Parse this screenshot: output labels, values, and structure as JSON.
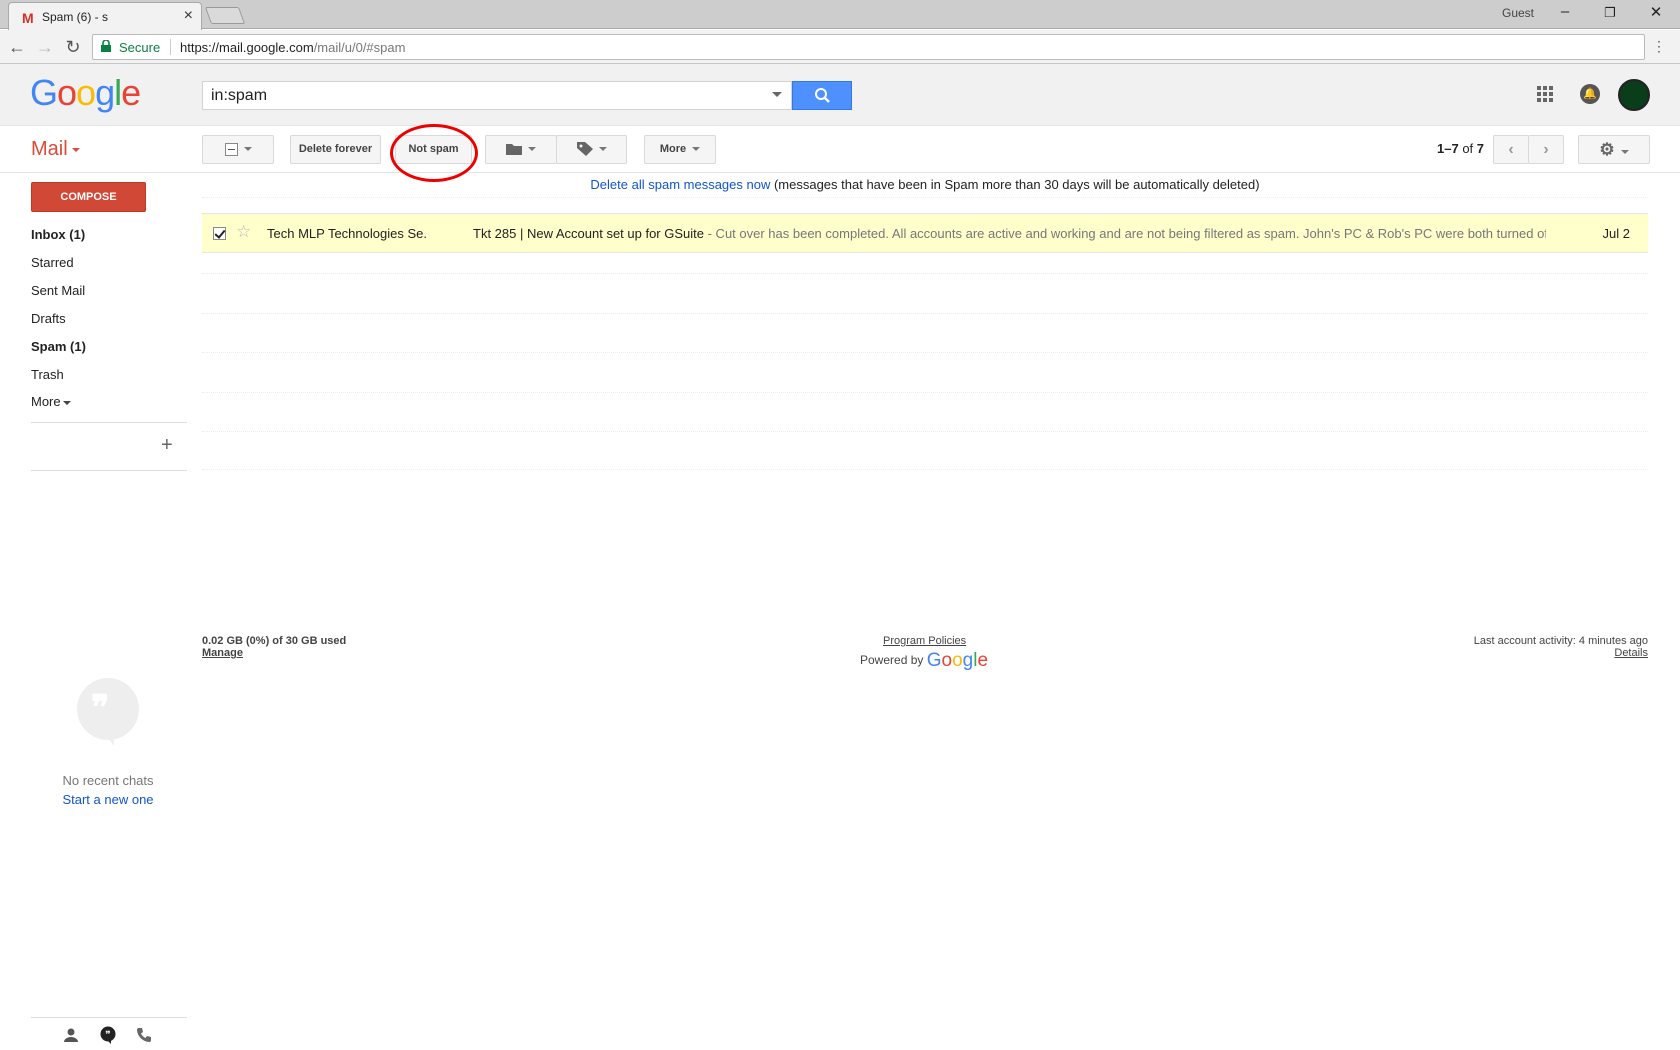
{
  "browser": {
    "tab_title": "Spam (6) - s",
    "profile": "Guest",
    "secure_label": "Secure",
    "url_host": "https://mail.google.com",
    "url_path": "/mail/u/0/#spam"
  },
  "header": {
    "logo_text": "Google",
    "search_value": "in:spam"
  },
  "toolbar": {
    "mail_label": "Mail",
    "delete_forever": "Delete forever",
    "not_spam": "Not spam",
    "more": "More",
    "pager_range": "1–7",
    "pager_of": "of",
    "pager_total": "7"
  },
  "sidebar": {
    "compose": "COMPOSE",
    "items": [
      {
        "label": "Inbox (1)"
      },
      {
        "label": "Starred"
      },
      {
        "label": "Sent Mail"
      },
      {
        "label": "Drafts"
      },
      {
        "label": "Spam (1)"
      },
      {
        "label": "Trash"
      },
      {
        "label": "More"
      }
    ]
  },
  "notice": {
    "link": "Delete all spam messages now",
    "text": " (messages that have been in Spam more than 30 days will be automatically deleted)"
  },
  "messages": [
    {
      "sender": "Tech MLP Technologies Se.",
      "subject": "Tkt 285 | New Account set up for GSuite",
      "snippet": " - Cut over has been completed. All accounts are active and working and are not being filtered as spam. John's PC & Rob's PC were both turned off s",
      "date": "Jul 2"
    }
  ],
  "footer": {
    "storage": "0.02 GB (0%) of 30 GB used",
    "manage": "Manage",
    "program_policies": "Program Policies",
    "powered_by": "Powered by",
    "last_activity": "Last account activity: 4 minutes ago",
    "details": "Details"
  },
  "hangouts": {
    "no_chats": "No recent chats",
    "start_new": "Start a new one"
  },
  "colors": {
    "accent_red": "#dd4b39",
    "search_blue": "#4d90fe",
    "row_highlight": "#ffffcc"
  }
}
